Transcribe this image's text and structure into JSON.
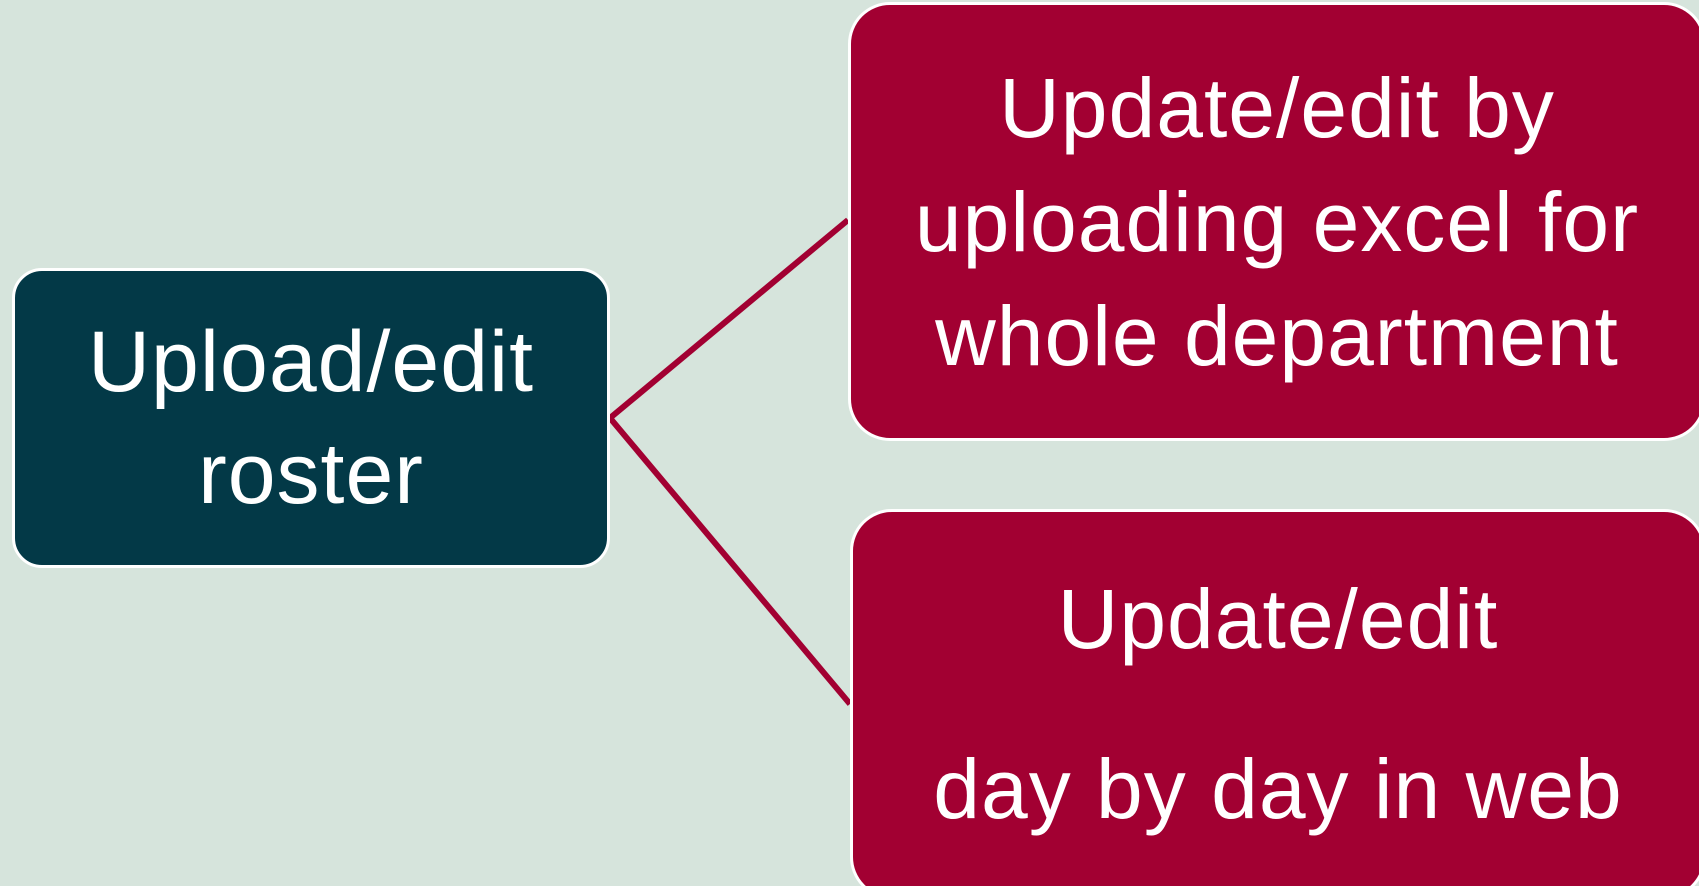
{
  "diagram": {
    "root": {
      "lines": [
        "Upload/edit",
        "roster"
      ]
    },
    "children": [
      {
        "lines": [
          "Update/edit by",
          "uploading excel for",
          "whole department"
        ]
      },
      {
        "lines": [
          "Update/edit",
          "day by day in web"
        ]
      }
    ]
  },
  "colors": {
    "background": "#d6e4dc",
    "root_fill": "#033947",
    "child_fill": "#a20032",
    "connector": "#a20032",
    "text": "#ffffff"
  }
}
